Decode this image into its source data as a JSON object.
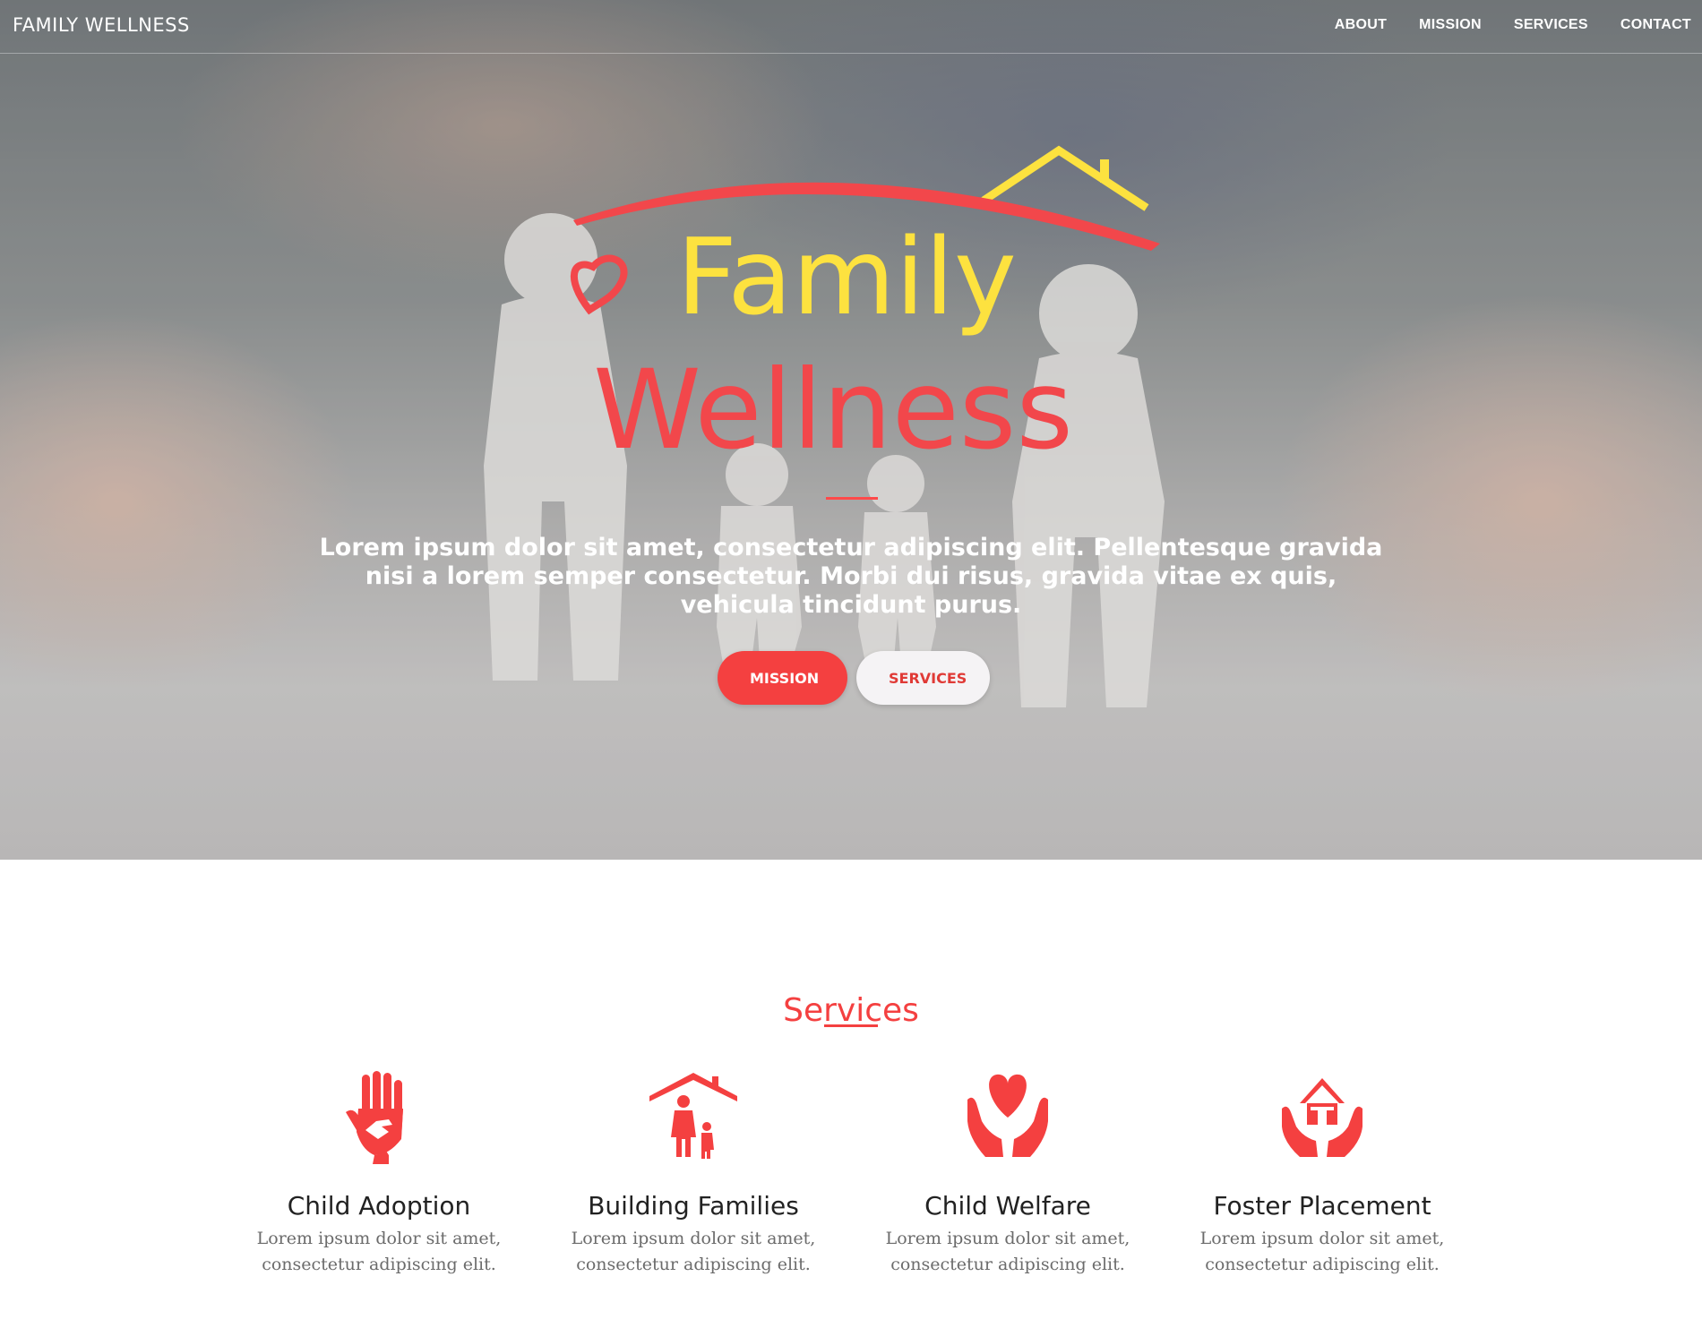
{
  "brand": "FAMILY WELLNESS",
  "nav": [
    "ABOUT",
    "MISSION",
    "SERVICES",
    "CONTACT"
  ],
  "hero": {
    "logo_line1": "Family",
    "logo_line2": "Wellness",
    "tagline": "Lorem ipsum dolor sit amet, consectetur adipiscing elit. Pellentesque gravida nisi a lorem semper consectetur. Morbi dui risus, gravida vitae ex quis, vehicula tincidunt purus.",
    "primary_button": "MISSION",
    "secondary_button": "SERVICES"
  },
  "services": {
    "title": "Services",
    "items": [
      {
        "icon": "hand-holding-child-hand-icon",
        "title": "Child Adoption",
        "desc": "Lorem ipsum dolor sit amet, consectetur adipiscing elit."
      },
      {
        "icon": "house-roof-mother-child-icon",
        "title": "Building Families",
        "desc": "Lorem ipsum dolor sit amet, consectetur adipiscing elit."
      },
      {
        "icon": "hands-holding-heart-icon",
        "title": "Child Welfare",
        "desc": "Lorem ipsum dolor sit amet, consectetur adipiscing elit."
      },
      {
        "icon": "hands-holding-house-icon",
        "title": "Foster Placement",
        "desc": "Lorem ipsum dolor sit amet, consectetur adipiscing elit."
      }
    ]
  },
  "colors": {
    "accent": "#f44040",
    "logo_yellow": "#fde23f",
    "logo_red": "#f2474b"
  }
}
